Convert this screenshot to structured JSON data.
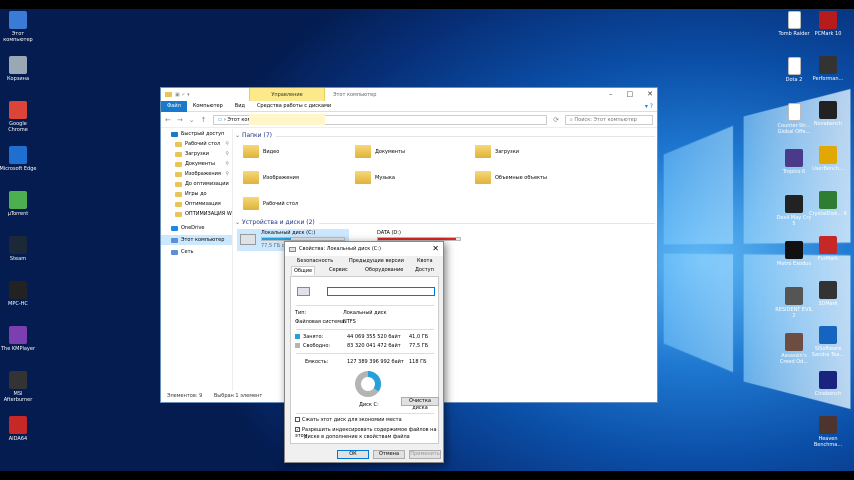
{
  "desktop": {
    "left_icons": [
      {
        "label": "Этот компьютер",
        "icon": "computer-icon",
        "color": "#3a7bd5"
      },
      {
        "label": "Корзина",
        "icon": "recycle-bin-icon",
        "color": "#9aa7b5"
      },
      {
        "label": "Google Chrome",
        "icon": "chrome-icon",
        "color": "#db4437"
      },
      {
        "label": "Microsoft Edge",
        "icon": "edge-icon",
        "color": "#1f6fd0"
      },
      {
        "label": "µTorrent",
        "icon": "utorrent-icon",
        "color": "#4caf50"
      },
      {
        "label": "Steam",
        "icon": "steam-icon",
        "color": "#1b2838"
      },
      {
        "label": "MPC-HC",
        "icon": "mpc-icon",
        "color": "#222"
      },
      {
        "label": "The KMPlayer",
        "icon": "kmplayer-icon",
        "color": "#7b3fb0"
      },
      {
        "label": "MSI Afterburner",
        "icon": "afterburner-icon",
        "color": "#333"
      },
      {
        "label": "AIDA64",
        "icon": "aida-icon",
        "color": "#c62828"
      }
    ],
    "right_icons_col1": [
      {
        "label": "Tomb Raider",
        "icon": "file-icon",
        "color": "#fff"
      },
      {
        "label": "Dota 2",
        "icon": "file-icon",
        "color": "#fff"
      },
      {
        "label": "Counter-Str... Global Offe...",
        "icon": "file-icon",
        "color": "#fff"
      },
      {
        "label": "Tropico 6",
        "icon": "tropico-icon",
        "color": "#4a3a8a"
      },
      {
        "label": "Devil May Cry 5",
        "icon": "dmc-icon",
        "color": "#222"
      },
      {
        "label": "Metro Exodus",
        "icon": "metro-icon",
        "color": "#111"
      },
      {
        "label": "RESIDENT EVIL 2",
        "icon": "re2-icon",
        "color": "#555"
      },
      {
        "label": "Assassin's Creed Od...",
        "icon": "ac-icon",
        "color": "#6d4c41"
      }
    ],
    "right_icons_col2": [
      {
        "label": "PCMark 10",
        "icon": "pcmark-icon",
        "color": "#b71c1c"
      },
      {
        "label": "Performan...",
        "icon": "performance-icon",
        "color": "#333"
      },
      {
        "label": "Novabench",
        "icon": "novabench-icon",
        "color": "#222"
      },
      {
        "label": "UserBench...",
        "icon": "userbench-icon",
        "color": "#e0a800"
      },
      {
        "label": "CrystalDisk... 6",
        "icon": "crystaldisk-icon",
        "color": "#2e7d32"
      },
      {
        "label": "FurMark",
        "icon": "furmark-icon",
        "color": "#c62828"
      },
      {
        "label": "3DMark",
        "icon": "3dmark-icon",
        "color": "#333"
      },
      {
        "label": "SiSoftware Sandra Tea...",
        "icon": "sandra-icon",
        "color": "#1565c0"
      },
      {
        "label": "Cinebench",
        "icon": "cinebench-icon",
        "color": "#1a237e"
      },
      {
        "label": "Heaven Benchma...",
        "icon": "heaven-icon",
        "color": "#4e342e"
      }
    ]
  },
  "explorer": {
    "title": "Этот компьютер",
    "context_tab": "Управление",
    "ribbon_tabs": [
      "Файл",
      "Компьютер",
      "Вид",
      "Средства работы с дисками"
    ],
    "address": "Этот компьютер",
    "search_placeholder": "Поиск: Этот компьютер",
    "sidebar": [
      {
        "label": "Быстрый доступ",
        "level": 0,
        "pinned": false
      },
      {
        "label": "Рабочий стол",
        "level": 1,
        "pinned": true
      },
      {
        "label": "Загрузки",
        "level": 1,
        "pinned": true
      },
      {
        "label": "Документы",
        "level": 1,
        "pinned": true
      },
      {
        "label": "Изображения",
        "level": 1,
        "pinned": true
      },
      {
        "label": "До оптимизации",
        "level": 1,
        "pinned": false
      },
      {
        "label": "Игры до",
        "level": 1,
        "pinned": false
      },
      {
        "label": "Оптимизация",
        "level": 1,
        "pinned": false
      },
      {
        "label": "ОПТИМИЗАЦИЯ W",
        "level": 1,
        "pinned": false
      },
      {
        "label": "OneDrive",
        "level": 0,
        "pinned": false
      },
      {
        "label": "Этот компьютер",
        "level": 0,
        "pinned": false,
        "selected": true
      },
      {
        "label": "Сеть",
        "level": 0,
        "pinned": false
      }
    ],
    "folders_header": "Папки (7)",
    "folders": [
      "Видео",
      "Документы",
      "Загрузки",
      "Изображения",
      "Музыка",
      "Объемные объекты",
      "Рабочий стол"
    ],
    "drives_header": "Устройства и диски (2)",
    "drives": [
      {
        "name": "Локальный диск (C:)",
        "info": "77,5 ГБ с",
        "used_fraction": 0.35,
        "color": "#26a0da"
      },
      {
        "name": "DATA (D:)",
        "info": "",
        "used_fraction": 0.95,
        "color": "#da2626"
      }
    ],
    "status": {
      "count": "Элементов: 9",
      "selected": "Выбран 1 элемент"
    }
  },
  "properties": {
    "title": "Свойства: Локальный диск (C:)",
    "tabs_row1": [
      "Безопасность",
      "Предыдущие версии",
      "Квота"
    ],
    "tabs_row2": [
      "Общие",
      "Сервис",
      "Оборудование",
      "Доступ"
    ],
    "name_value": "",
    "type_label": "Тип:",
    "type_value": "Локальный диск",
    "fs_label": "Файловая система:",
    "fs_value": "NTFS",
    "used_label": "Занято:",
    "used_bytes": "44 069 355 520 байт",
    "used_gb": "41,0 ГБ",
    "free_label": "Свободно:",
    "free_bytes": "83 320 041 472 байт",
    "free_gb": "77,5 ГБ",
    "cap_label": "Емкость:",
    "cap_bytes": "127 389 396 992 байт",
    "cap_gb": "118 ГБ",
    "used_fraction": 0.346,
    "used_color": "#26a0da",
    "free_color": "#b4b4b4",
    "disk_label": "Диск C:",
    "cleanup_button": "Очистка диска",
    "compress_label": "Сжать этот диск для экономии места",
    "compress_checked": false,
    "index_label_1": "Разрешить индексировать содержимое файлов на этом",
    "index_label_2": "диске в дополнение к свойствам файла",
    "index_checked": true,
    "ok": "ОК",
    "cancel": "Отмена",
    "apply": "Применить"
  }
}
